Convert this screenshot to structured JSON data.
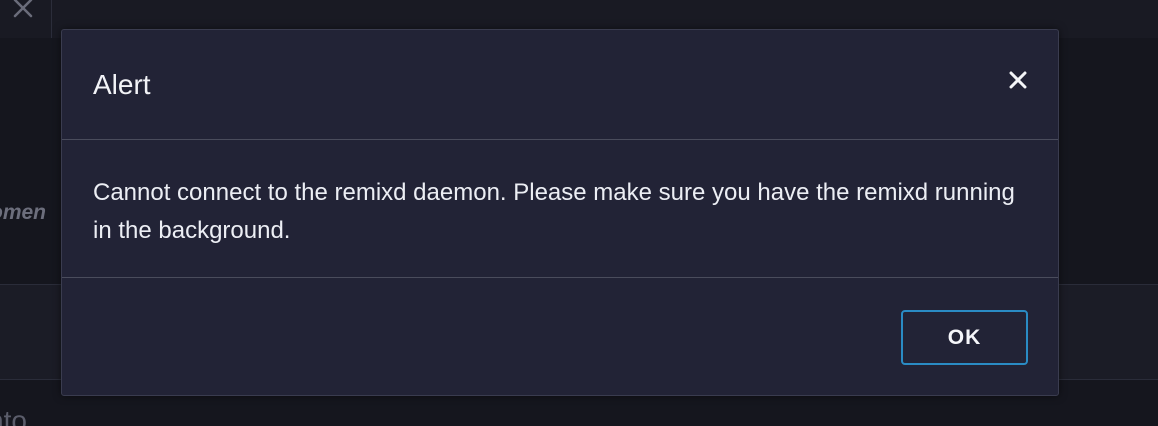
{
  "background": {
    "left_text_fragment": "omen",
    "bottom_text_fragment": "nto"
  },
  "modal": {
    "title": "Alert",
    "close_icon": "close-icon",
    "message": "Cannot connect to the remixd daemon. Please make sure you have the remixd running in the background.",
    "ok_label": "OK"
  },
  "colors": {
    "accent_border": "#2a8bc4",
    "modal_background": "#222336",
    "page_background": "#15161e"
  }
}
